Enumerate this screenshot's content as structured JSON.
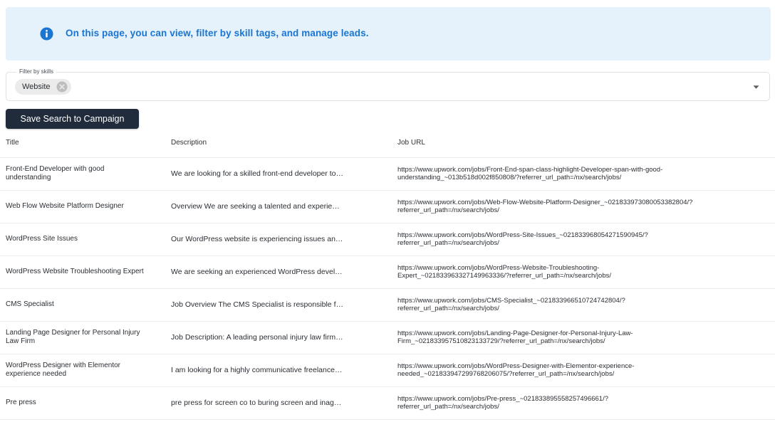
{
  "banner": {
    "text": "On this page, you can view, filter by skill tags, and manage leads.",
    "icon": "info-icon",
    "text_color": "#1976d2",
    "background": "#e5f1fb"
  },
  "filter": {
    "label": "Filter by skills",
    "chips": [
      {
        "label": "Website"
      }
    ],
    "dropdown_icon": "arrow-drop-down-icon"
  },
  "actions": {
    "save_label": "Save Search to Campaign",
    "button_color": "#202b3b"
  },
  "table": {
    "headers": {
      "title": "Title",
      "description": "Description",
      "job_url": "Job URL"
    },
    "rows": [
      {
        "title": "Front-End Developer with good understanding",
        "description": "We are looking for a skilled front-end developer to…",
        "url_line1": "https://www.upwork.com/jobs/Front-End-span-class-highlight-Developer-span-with-good-",
        "url_line2": "understanding_~013b518d002f850808/?referrer_url_path=/nx/search/jobs/"
      },
      {
        "title": "Web Flow Website Platform Designer",
        "description": "Overview We are seeking a talented and experie…",
        "url_line1": "https://www.upwork.com/jobs/Web-Flow-Website-Platform-Designer_~021833973080053382804/?",
        "url_line2": "referrer_url_path=/nx/search/jobs/"
      },
      {
        "title": "WordPress Site Issues",
        "description": "Our WordPress website is experiencing issues an…",
        "url_line1": "https://www.upwork.com/jobs/WordPress-Site-Issues_~021833968054271590945/?",
        "url_line2": "referrer_url_path=/nx/search/jobs/"
      },
      {
        "title": "WordPress Website Troubleshooting Expert",
        "description": "We are seeking an experienced WordPress devel…",
        "url_line1": "https://www.upwork.com/jobs/WordPress-Website-Troubleshooting-",
        "url_line2": "Expert_~021833963327149963336/?referrer_url_path=/nx/search/jobs/"
      },
      {
        "title": "CMS Specialist",
        "description": "Job Overview The CMS Specialist is responsible f…",
        "url_line1": "https://www.upwork.com/jobs/CMS-Specialist_~021833966510724742804/?",
        "url_line2": "referrer_url_path=/nx/search/jobs/"
      },
      {
        "title": "Landing Page Designer for Personal Injury Law Firm",
        "description": "Job Description: A leading personal injury law firm…",
        "url_line1": "https://www.upwork.com/jobs/Landing-Page-Designer-for-Personal-Injury-Law-",
        "url_line2": "Firm_~021833957510823133729/?referrer_url_path=/nx/search/jobs/"
      },
      {
        "title": "WordPress Designer with Elementor experience needed",
        "description": "I am looking for a highly communicative freelance…",
        "url_line1": "https://www.upwork.com/jobs/WordPress-Designer-with-Elementor-experience-",
        "url_line2": "needed_~021833947299768206075/?referrer_url_path=/nx/search/jobs/"
      },
      {
        "title": "Pre press",
        "description": "pre press for screen co to buring screen and inag…",
        "url_line1": "https://www.upwork.com/jobs/Pre-press_~021833895558257496661/?",
        "url_line2": "referrer_url_path=/nx/search/jobs/"
      }
    ]
  }
}
